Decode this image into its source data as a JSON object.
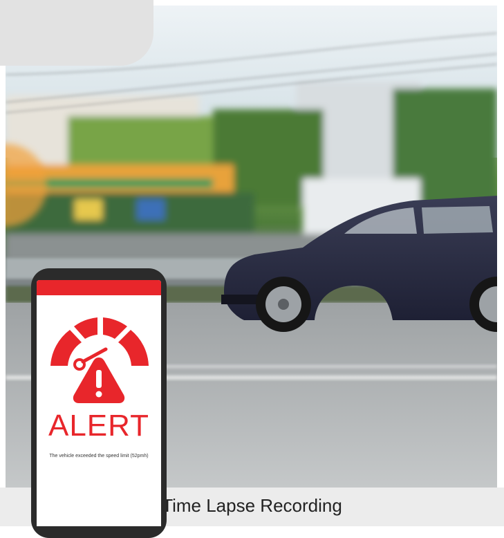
{
  "phone": {
    "alert_title": "ALERT",
    "alert_message": "The vehicle exceeded the speed limit (52pmh)",
    "icons": [
      "speedometer-icon",
      "warning-icon"
    ]
  },
  "caption": "Time Lapse Recording",
  "colors": {
    "alert_red": "#e8262b",
    "caption_bg": "#ececec",
    "corner_tab": "#e2e2e2"
  }
}
